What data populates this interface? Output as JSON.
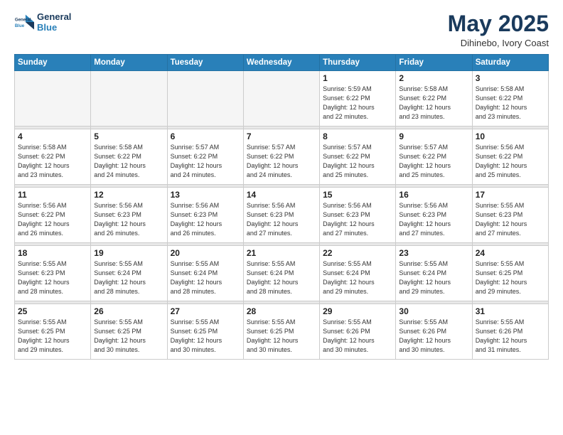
{
  "logo": {
    "line1": "General",
    "line2": "Blue"
  },
  "title": "May 2025",
  "location": "Dihinebo, Ivory Coast",
  "days_of_week": [
    "Sunday",
    "Monday",
    "Tuesday",
    "Wednesday",
    "Thursday",
    "Friday",
    "Saturday"
  ],
  "weeks": [
    [
      {
        "day": "",
        "info": ""
      },
      {
        "day": "",
        "info": ""
      },
      {
        "day": "",
        "info": ""
      },
      {
        "day": "",
        "info": ""
      },
      {
        "day": "1",
        "info": "Sunrise: 5:59 AM\nSunset: 6:22 PM\nDaylight: 12 hours\nand 22 minutes."
      },
      {
        "day": "2",
        "info": "Sunrise: 5:58 AM\nSunset: 6:22 PM\nDaylight: 12 hours\nand 23 minutes."
      },
      {
        "day": "3",
        "info": "Sunrise: 5:58 AM\nSunset: 6:22 PM\nDaylight: 12 hours\nand 23 minutes."
      }
    ],
    [
      {
        "day": "4",
        "info": "Sunrise: 5:58 AM\nSunset: 6:22 PM\nDaylight: 12 hours\nand 23 minutes."
      },
      {
        "day": "5",
        "info": "Sunrise: 5:58 AM\nSunset: 6:22 PM\nDaylight: 12 hours\nand 24 minutes."
      },
      {
        "day": "6",
        "info": "Sunrise: 5:57 AM\nSunset: 6:22 PM\nDaylight: 12 hours\nand 24 minutes."
      },
      {
        "day": "7",
        "info": "Sunrise: 5:57 AM\nSunset: 6:22 PM\nDaylight: 12 hours\nand 24 minutes."
      },
      {
        "day": "8",
        "info": "Sunrise: 5:57 AM\nSunset: 6:22 PM\nDaylight: 12 hours\nand 25 minutes."
      },
      {
        "day": "9",
        "info": "Sunrise: 5:57 AM\nSunset: 6:22 PM\nDaylight: 12 hours\nand 25 minutes."
      },
      {
        "day": "10",
        "info": "Sunrise: 5:56 AM\nSunset: 6:22 PM\nDaylight: 12 hours\nand 25 minutes."
      }
    ],
    [
      {
        "day": "11",
        "info": "Sunrise: 5:56 AM\nSunset: 6:22 PM\nDaylight: 12 hours\nand 26 minutes."
      },
      {
        "day": "12",
        "info": "Sunrise: 5:56 AM\nSunset: 6:23 PM\nDaylight: 12 hours\nand 26 minutes."
      },
      {
        "day": "13",
        "info": "Sunrise: 5:56 AM\nSunset: 6:23 PM\nDaylight: 12 hours\nand 26 minutes."
      },
      {
        "day": "14",
        "info": "Sunrise: 5:56 AM\nSunset: 6:23 PM\nDaylight: 12 hours\nand 27 minutes."
      },
      {
        "day": "15",
        "info": "Sunrise: 5:56 AM\nSunset: 6:23 PM\nDaylight: 12 hours\nand 27 minutes."
      },
      {
        "day": "16",
        "info": "Sunrise: 5:56 AM\nSunset: 6:23 PM\nDaylight: 12 hours\nand 27 minutes."
      },
      {
        "day": "17",
        "info": "Sunrise: 5:55 AM\nSunset: 6:23 PM\nDaylight: 12 hours\nand 27 minutes."
      }
    ],
    [
      {
        "day": "18",
        "info": "Sunrise: 5:55 AM\nSunset: 6:23 PM\nDaylight: 12 hours\nand 28 minutes."
      },
      {
        "day": "19",
        "info": "Sunrise: 5:55 AM\nSunset: 6:24 PM\nDaylight: 12 hours\nand 28 minutes."
      },
      {
        "day": "20",
        "info": "Sunrise: 5:55 AM\nSunset: 6:24 PM\nDaylight: 12 hours\nand 28 minutes."
      },
      {
        "day": "21",
        "info": "Sunrise: 5:55 AM\nSunset: 6:24 PM\nDaylight: 12 hours\nand 28 minutes."
      },
      {
        "day": "22",
        "info": "Sunrise: 5:55 AM\nSunset: 6:24 PM\nDaylight: 12 hours\nand 29 minutes."
      },
      {
        "day": "23",
        "info": "Sunrise: 5:55 AM\nSunset: 6:24 PM\nDaylight: 12 hours\nand 29 minutes."
      },
      {
        "day": "24",
        "info": "Sunrise: 5:55 AM\nSunset: 6:25 PM\nDaylight: 12 hours\nand 29 minutes."
      }
    ],
    [
      {
        "day": "25",
        "info": "Sunrise: 5:55 AM\nSunset: 6:25 PM\nDaylight: 12 hours\nand 29 minutes."
      },
      {
        "day": "26",
        "info": "Sunrise: 5:55 AM\nSunset: 6:25 PM\nDaylight: 12 hours\nand 30 minutes."
      },
      {
        "day": "27",
        "info": "Sunrise: 5:55 AM\nSunset: 6:25 PM\nDaylight: 12 hours\nand 30 minutes."
      },
      {
        "day": "28",
        "info": "Sunrise: 5:55 AM\nSunset: 6:25 PM\nDaylight: 12 hours\nand 30 minutes."
      },
      {
        "day": "29",
        "info": "Sunrise: 5:55 AM\nSunset: 6:26 PM\nDaylight: 12 hours\nand 30 minutes."
      },
      {
        "day": "30",
        "info": "Sunrise: 5:55 AM\nSunset: 6:26 PM\nDaylight: 12 hours\nand 30 minutes."
      },
      {
        "day": "31",
        "info": "Sunrise: 5:55 AM\nSunset: 6:26 PM\nDaylight: 12 hours\nand 31 minutes."
      }
    ]
  ]
}
